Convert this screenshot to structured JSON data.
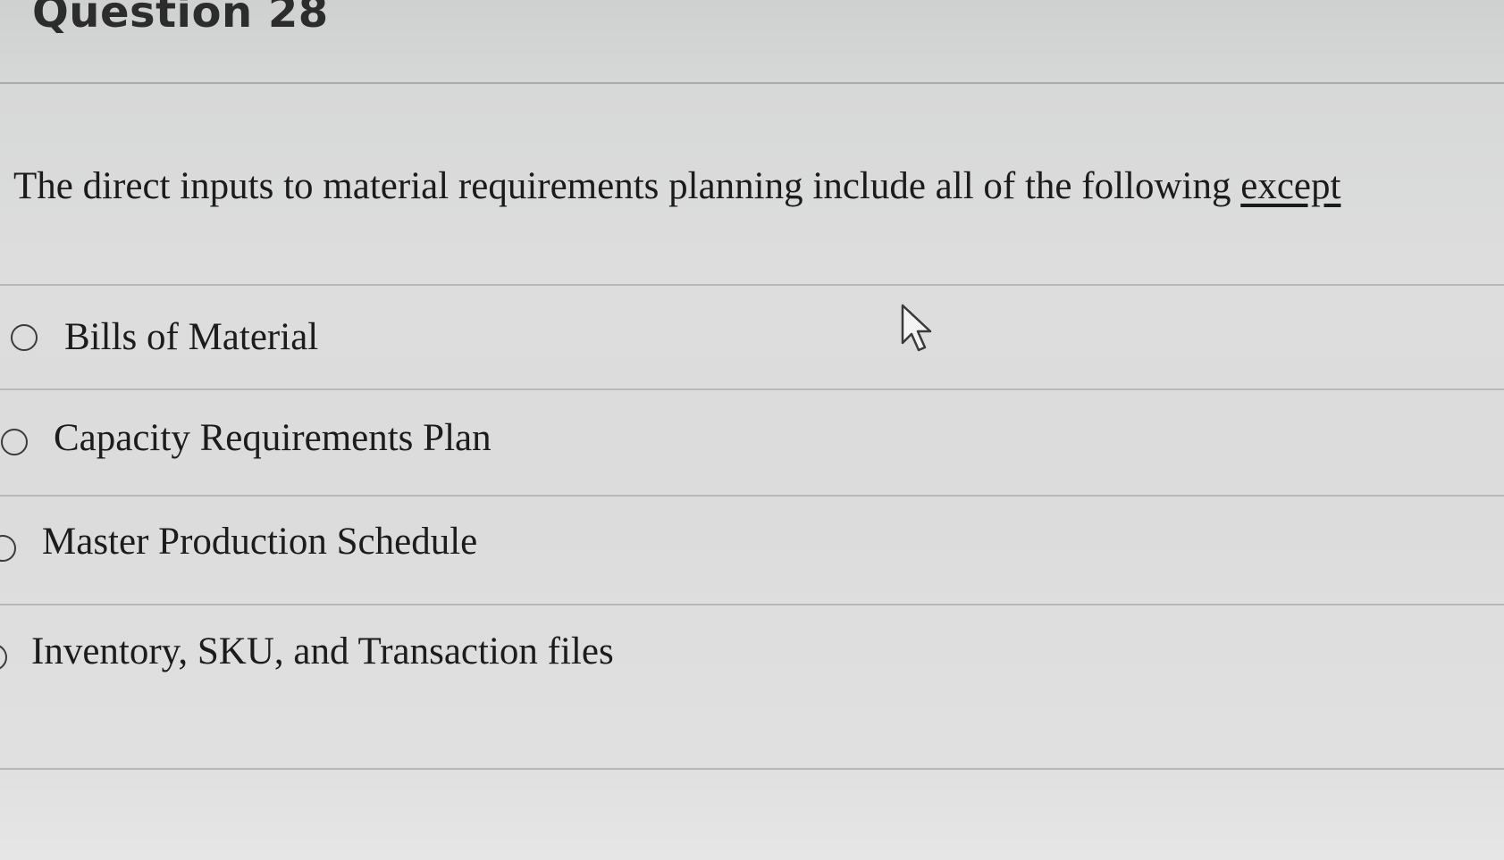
{
  "question": {
    "title": "Question 28",
    "prompt_main": "The direct inputs to material requirements planning include all of the following ",
    "prompt_emphasis": "except"
  },
  "options": [
    {
      "label": "Bills of Material",
      "selected": false
    },
    {
      "label": "Capacity Requirements Plan",
      "selected": false
    },
    {
      "label": "Master Production Schedule",
      "selected": false
    },
    {
      "label": "Inventory, SKU, and Transaction files",
      "selected": false
    }
  ],
  "icons": {
    "radio": "radio-button-icon",
    "cursor": "mouse-pointer-icon"
  },
  "colors": {
    "background": "#dcdcdc",
    "text": "#1e1e1e",
    "divider": "#b7b8b8"
  }
}
